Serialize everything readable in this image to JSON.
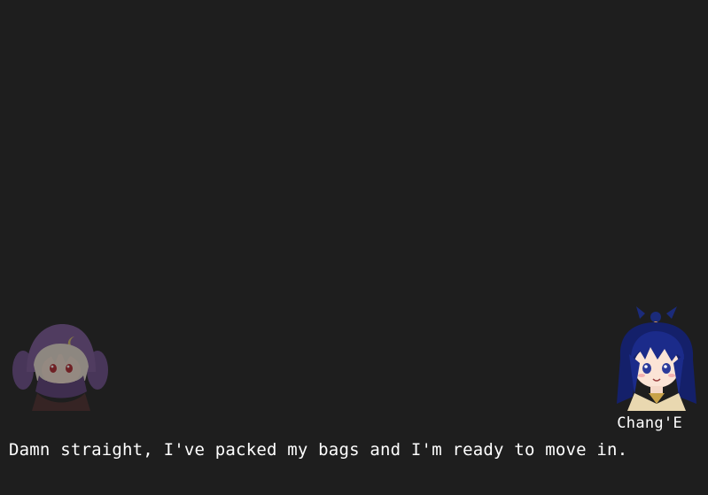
{
  "dialogue": {
    "speaker": "Chang'E",
    "text": "Damn straight, I've packed my bags and I'm ready to move in."
  },
  "portraits": {
    "left": {
      "icon": "hooded-girl-portrait-icon",
      "state": "inactive"
    },
    "right": {
      "icon": "change-portrait-icon",
      "state": "active"
    }
  },
  "colors": {
    "background": "#1e1e1e",
    "text": "#ffffff"
  }
}
